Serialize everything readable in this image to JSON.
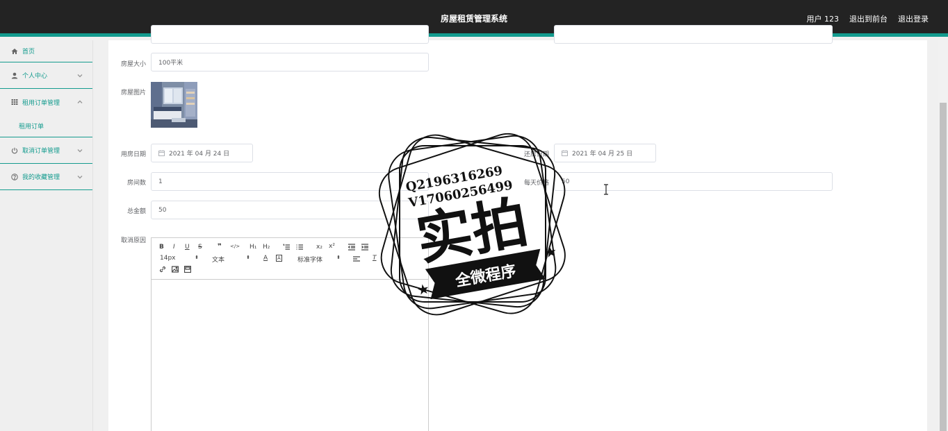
{
  "header": {
    "title": "房屋租赁管理系统",
    "user": "用户 123",
    "to_front": "退出到前台",
    "logout": "退出登录"
  },
  "sidebar": {
    "home": "首页",
    "personal": "个人中心",
    "rent_orders": "租用订单管理",
    "rent_orders_sub": "租用订单",
    "cancel_orders": "取消订单管理",
    "favorites": "我的收藏管理"
  },
  "form": {
    "size_label": "房屋大小",
    "size_value": "100平米",
    "image_label": "房屋图片",
    "rent_date_label": "用房日期",
    "rent_date_value": "2021 年 04 月 24 日",
    "return_date_label": "还房日期",
    "return_date_value": "2021 年 04 月 25 日",
    "rooms_label": "房间数",
    "rooms_value": "1",
    "daily_price_label": "每天价格",
    "daily_price_value": "50",
    "total_label": "总金额",
    "total_value": "50",
    "reason_label": "取消原因"
  },
  "editor": {
    "font_size": "14px",
    "text_style": "文本",
    "font_family": "标准字体"
  },
  "stamp": {
    "line1": "Q2196316269",
    "line2": "V17060256499",
    "big": "实拍",
    "banner": "全微程序"
  }
}
